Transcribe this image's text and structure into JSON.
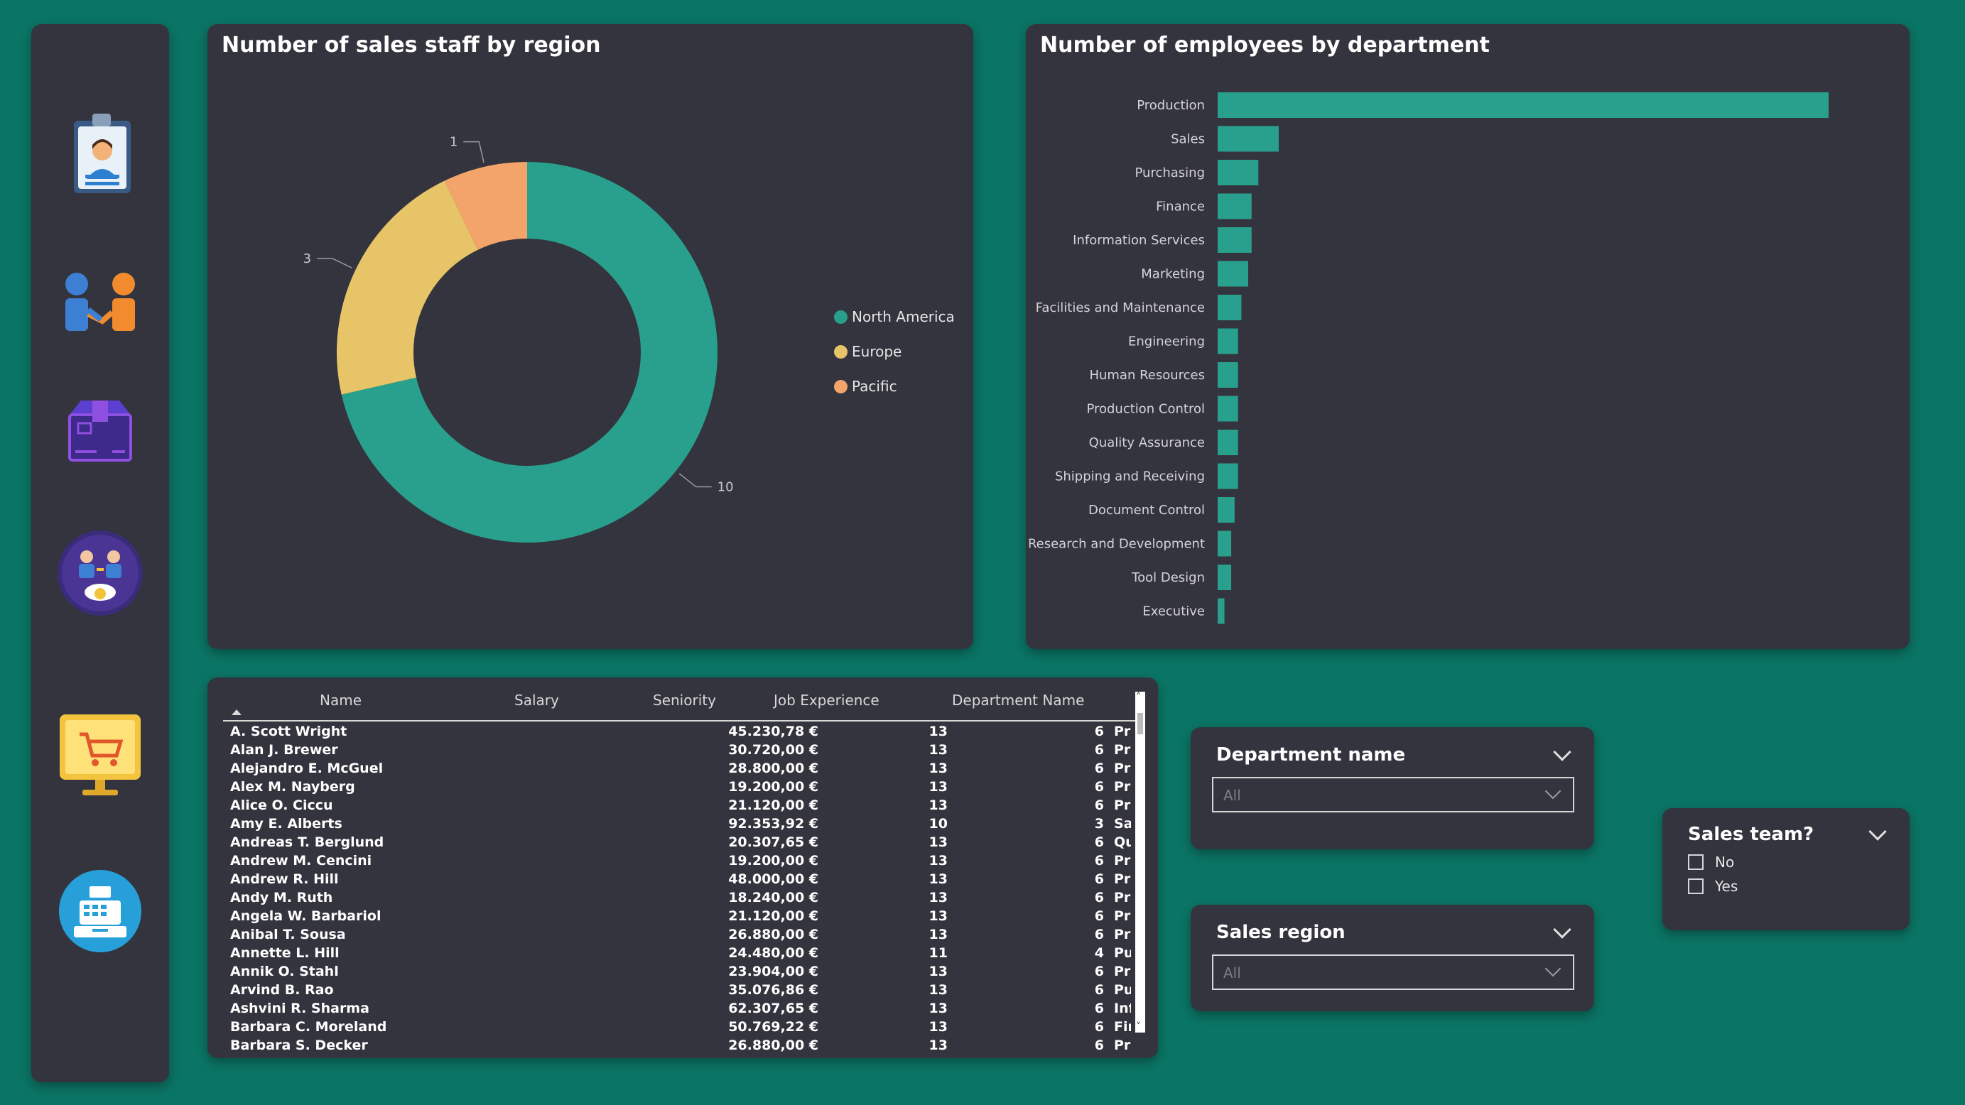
{
  "sidebar": {
    "icons": [
      "employee-badge-icon",
      "handshake-icon",
      "product-box-icon",
      "team-finance-icon",
      "shopping-cart-monitor-icon",
      "cash-register-icon"
    ]
  },
  "donut_chart": {
    "title": "Number of sales staff by region",
    "legend": [
      "North America",
      "Europe",
      "Pacific"
    ],
    "colors": {
      "North America": "#29a08d",
      "Europe": "#e8c468",
      "Pacific": "#f2a46a"
    }
  },
  "bar_chart": {
    "title": "Number of employees by department",
    "bar_color": "#29a08d"
  },
  "chart_data": [
    {
      "type": "pie",
      "title": "Number of sales staff by region",
      "categories": [
        "North America",
        "Europe",
        "Pacific"
      ],
      "values": [
        10,
        3,
        1
      ],
      "legend_position": "right"
    },
    {
      "type": "bar",
      "orientation": "horizontal",
      "title": "Number of employees by department",
      "categories": [
        "Production",
        "Sales",
        "Purchasing",
        "Finance",
        "Information Services",
        "Marketing",
        "Facilities and Maintenance",
        "Engineering",
        "Human Resources",
        "Production Control",
        "Quality Assurance",
        "Shipping and Receiving",
        "Document Control",
        "Research and Development",
        "Tool Design",
        "Executive"
      ],
      "values": [
        180,
        18,
        12,
        10,
        10,
        9,
        7,
        6,
        6,
        6,
        6,
        6,
        5,
        4,
        4,
        2
      ]
    }
  ],
  "table": {
    "columns": [
      "Name",
      "Salary",
      "Seniority",
      "Job Experience",
      "Department Name"
    ],
    "rows": [
      [
        "A. Scott Wright",
        "45.230,78 €",
        "13",
        "6",
        "Production Control"
      ],
      [
        "Alan J. Brewer",
        "30.720,00 €",
        "13",
        "6",
        "Production Control"
      ],
      [
        "Alejandro E. McGuel",
        "28.800,00 €",
        "13",
        "6",
        "Production"
      ],
      [
        "Alex M. Nayberg",
        "19.200,00 €",
        "13",
        "6",
        "Production"
      ],
      [
        "Alice O. Ciccu",
        "21.120,00 €",
        "13",
        "6",
        "Production"
      ],
      [
        "Amy E. Alberts",
        "92.353,92 €",
        "10",
        "3",
        "Sales"
      ],
      [
        "Andreas T. Berglund",
        "20.307,65 €",
        "13",
        "6",
        "Quality Assurance"
      ],
      [
        "Andrew M. Cencini",
        "19.200,00 €",
        "13",
        "6",
        "Production"
      ],
      [
        "Andrew R. Hill",
        "48.000,00 €",
        "13",
        "6",
        "Production"
      ],
      [
        "Andy M. Ruth",
        "18.240,00 €",
        "13",
        "6",
        "Production"
      ],
      [
        "Angela W. Barbariol",
        "21.120,00 €",
        "13",
        "6",
        "Production"
      ],
      [
        "Anibal T. Sousa",
        "26.880,00 €",
        "13",
        "6",
        "Production"
      ],
      [
        "Annette L. Hill",
        "24.480,00 €",
        "11",
        "4",
        "Purchasing"
      ],
      [
        "Annik O. Stahl",
        "23.904,00 €",
        "13",
        "6",
        "Production"
      ],
      [
        "Arvind B. Rao",
        "35.076,86 €",
        "13",
        "6",
        "Purchasing"
      ],
      [
        "Ashvini R. Sharma",
        "62.307,65 €",
        "13",
        "6",
        "Information Services"
      ],
      [
        "Barbara C. Moreland",
        "50.769,22 €",
        "13",
        "6",
        "Finance"
      ],
      [
        "Barbara S. Decker",
        "26.880,00 €",
        "13",
        "6",
        "Production"
      ]
    ]
  },
  "slicers": {
    "department": {
      "title": "Department name",
      "value": "All"
    },
    "region": {
      "title": "Sales region",
      "value": "All"
    },
    "sales_team": {
      "title": "Sales team?",
      "options": [
        "No",
        "Yes"
      ]
    }
  }
}
